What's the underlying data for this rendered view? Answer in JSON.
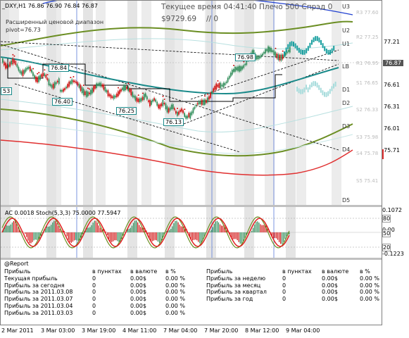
{
  "header": {
    "symbol_line": "_DXY,H1  76.86 76.90 76.84 76.87",
    "range_label": "Расширенный ценовой диапазон",
    "pivot_label": "pivot=76.73",
    "status": "Текущее время 04:41:40 Плечо 500 Спрэд 0",
    "balance": "$9729.69",
    "balance_extra": "// 0"
  },
  "pivot_levels": {
    "u3": "U3",
    "u2": "U2",
    "u1": "U1",
    "lb": "LB",
    "d1": "D1",
    "d2": "D2",
    "d3": "D3",
    "d4": "D4",
    "d5": "D5",
    "r3": "R3 77.60",
    "r2": "R2 77.25",
    "r1": "R1 76.95",
    "s1": "S1 76.65",
    "s2": "S2 76.33",
    "s3": "S3 75.98",
    "s4": "S4 75.78",
    "s5": "S5 75.41"
  },
  "price_axis": [
    "77.21",
    "76.87",
    "76.61",
    "76.31",
    "76.01",
    "75.71"
  ],
  "current_price": "76.87",
  "price_labels": [
    "76.84",
    "76.40",
    "76.25",
    "76.13",
    "76.98",
    "53"
  ],
  "indicator": {
    "title": "AC 0.0018  Stoch(5,3,3) 75.0000 77.5947",
    "axis": [
      "0.1072",
      "80",
      "0.00",
      "50",
      "20",
      "-0.1223"
    ]
  },
  "report": {
    "title": "@Report",
    "left_headers": [
      "Прибыль",
      "в пунктах",
      "в валюте",
      "в %"
    ],
    "left_rows": [
      [
        "Текущая прибыль",
        "0",
        "0.00$",
        "0.00 %"
      ],
      [
        "Прибыль за сегодня",
        "0",
        "0.00$",
        "0.00 %"
      ],
      [
        "Прибыль за 2011.03.08",
        "0",
        "0.00$",
        "0.00 %"
      ],
      [
        "Прибыль за 2011.03.07",
        "0",
        "0.00$",
        "0.00 %"
      ],
      [
        "Прибыль за 2011.03.04",
        "0",
        "0.00$",
        "0.00 %"
      ],
      [
        "Прибыль за 2011.03.03",
        "0",
        "0.00$",
        "0.00 %"
      ]
    ],
    "right_headers": [
      "Прибыль",
      "в пунктах",
      "в валюте",
      "в %"
    ],
    "right_rows": [
      [
        "Прибыль за неделю",
        "0",
        "0.00$",
        "0.00 %"
      ],
      [
        "Прибыль за месяц",
        "0",
        "0.00$",
        "0.00 %"
      ],
      [
        "Прибыль за квартал",
        "0",
        "0.00$",
        "0.00 %"
      ],
      [
        "Прибыль за год",
        "0",
        "0.00$",
        "0.00 %"
      ]
    ]
  },
  "time_axis": [
    "2 Mar 2011",
    "3 Mar 03:00",
    "3 Mar 19:00",
    "4 Mar 11:00",
    "7 Mar 04:00",
    "7 Mar 20:00",
    "8 Mar 12:00",
    "9 Mar 04:00"
  ],
  "colors": {
    "bull": "#2e8b57",
    "bear": "#d01010",
    "teal": "#1aa0a0",
    "olive": "#6b8e23",
    "blue": "#2040d0",
    "red_band": "#e03030"
  }
}
